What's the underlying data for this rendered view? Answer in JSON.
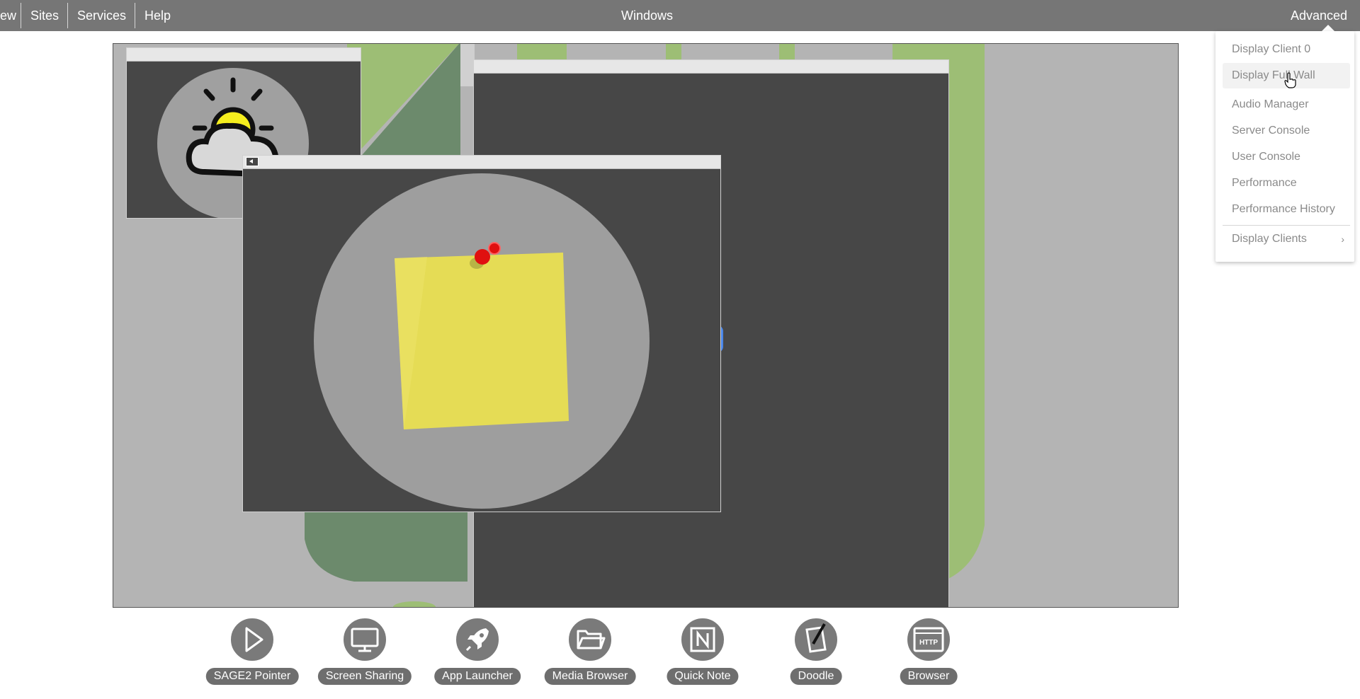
{
  "topbar": {
    "menus": [
      "ew",
      "Sites",
      "Services",
      "Help"
    ],
    "center_title": "Windows",
    "right_menu": "Advanced"
  },
  "dropdown": {
    "items": [
      "Display Client 0",
      "Display Full Wall",
      "Audio Manager",
      "Server Console",
      "User Console",
      "Performance",
      "Performance History",
      "Display Clients"
    ],
    "hovered_item": "Display Full Wall"
  },
  "dock": {
    "apps": [
      {
        "label": "SAGE2 Pointer",
        "icon": "pointer-icon"
      },
      {
        "label": "Screen Sharing",
        "icon": "monitor-icon"
      },
      {
        "label": "App Launcher",
        "icon": "rocket-icon"
      },
      {
        "label": "Media Browser",
        "icon": "folder-icon"
      },
      {
        "label": "Quick Note",
        "icon": "note-icon"
      },
      {
        "label": "Doodle",
        "icon": "doodle-icon"
      },
      {
        "label": "Browser",
        "icon": "http-icon"
      }
    ]
  },
  "wall": {
    "windows": [
      {
        "name": "weather-app-window",
        "icon": "weather-icon"
      },
      {
        "name": "large-app-window",
        "icon": ""
      },
      {
        "name": "quick-note-app-window",
        "icon": "sticky-note-icon"
      }
    ]
  },
  "colors": {
    "topbar": "#767676",
    "wall_background": "#b4b4b4",
    "map_green_light": "#9dbe75",
    "map_green_dark": "#6c8a6c",
    "window_body": "#474747",
    "sticky_note": "#e5dc55"
  }
}
